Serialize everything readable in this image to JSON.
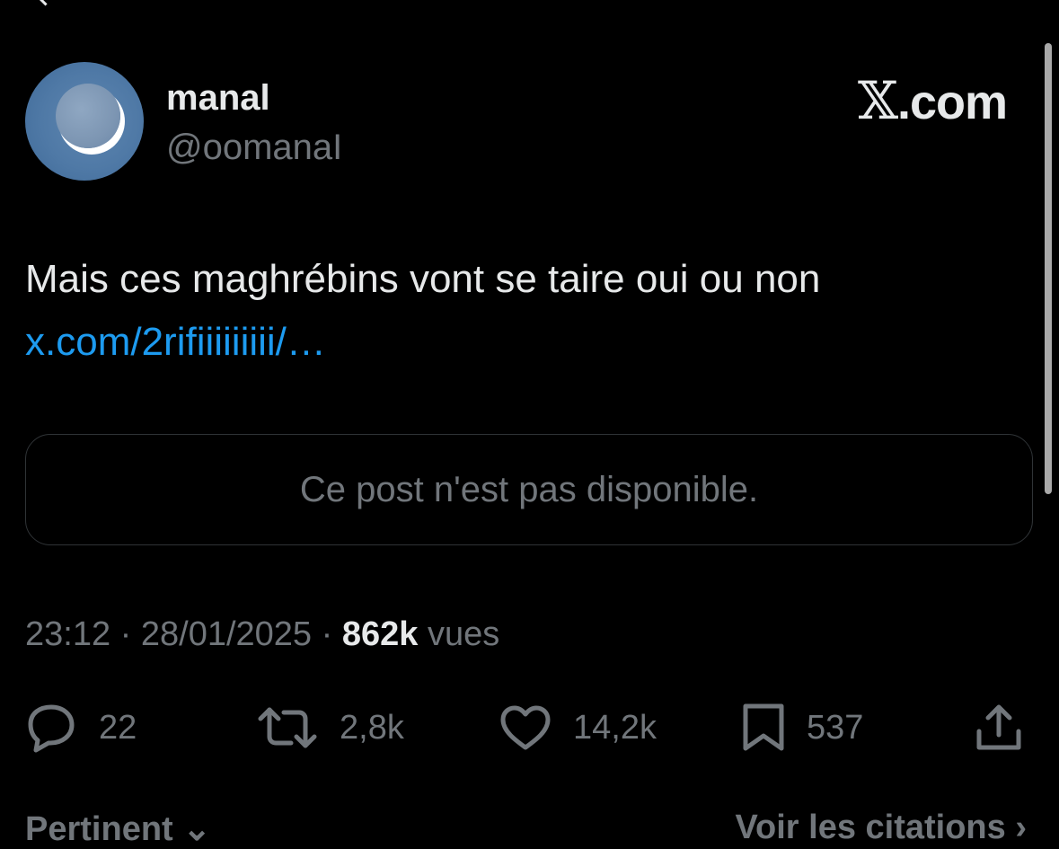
{
  "author": {
    "display_name": "manal",
    "handle": "@oomanaI"
  },
  "brand": {
    "text": ".com"
  },
  "tweet": {
    "text": "Mais ces maghrébins vont se taire oui ou non",
    "link": "x.com/2rifiiiiiiiii/…"
  },
  "quoted_post": {
    "message": "Ce post n'est pas disponible."
  },
  "meta": {
    "time": "23:12",
    "separator": " · ",
    "date": "28/01/2025",
    "views_count": "862k",
    "views_label": "vues"
  },
  "actions": {
    "replies": "22",
    "reposts": "2,8k",
    "likes": "14,2k",
    "bookmarks": "537"
  },
  "tabs": {
    "left": "Pertinent",
    "right": "Voir les citations"
  },
  "icons": {
    "reply": "reply-icon",
    "repost": "repost-icon",
    "like": "heart-icon",
    "bookmark": "bookmark-icon",
    "share": "share-icon"
  },
  "colors": {
    "background": "#000000",
    "text_primary": "#e7e9ea",
    "text_secondary": "#71767b",
    "link": "#1d9bf0",
    "border": "#2f3336"
  }
}
